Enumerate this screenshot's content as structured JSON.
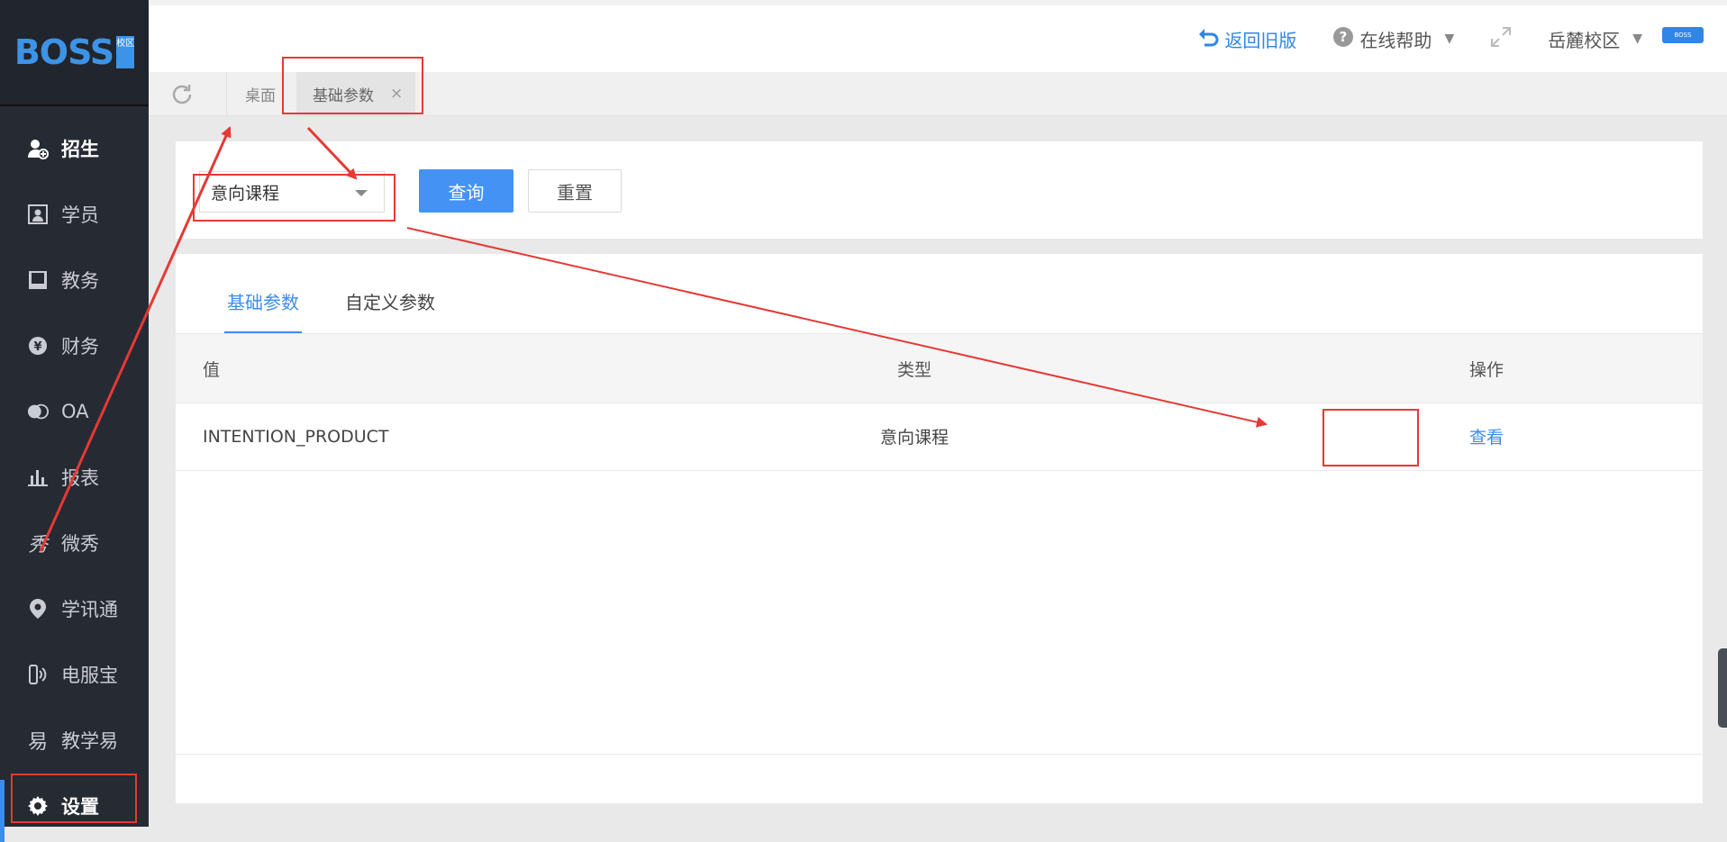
{
  "sidebar": {
    "logo": "BOSS",
    "logo_mark": "校区",
    "items": [
      {
        "label": "招生",
        "icon": "user-add-icon"
      },
      {
        "label": "学员",
        "icon": "student-card-icon"
      },
      {
        "label": "教务",
        "icon": "book-icon"
      },
      {
        "label": "财务",
        "icon": "yen-icon"
      },
      {
        "label": "OA",
        "icon": "chat-icon"
      },
      {
        "label": "报表",
        "icon": "bar-chart-icon"
      },
      {
        "label": "微秀",
        "icon": "xiu-icon"
      },
      {
        "label": "学讯通",
        "icon": "location-pin-icon"
      },
      {
        "label": "电服宝",
        "icon": "phone-service-icon"
      },
      {
        "label": "教学易",
        "icon": "teach-icon"
      },
      {
        "label": "设置",
        "icon": "gear-icon"
      }
    ]
  },
  "topbar": {
    "back_old": "返回旧版",
    "help": "在线帮助",
    "campus": "岳麓校区",
    "avatar_text": "BOSS"
  },
  "tabs": {
    "desk": "桌面",
    "basic": "基础参数",
    "close": "×"
  },
  "filter": {
    "select_value": "意向课程",
    "query": "查询",
    "reset": "重置"
  },
  "subtabs": {
    "basic": "基础参数",
    "custom": "自定义参数"
  },
  "table": {
    "headers": [
      "值",
      "类型",
      "操作"
    ],
    "rows": [
      {
        "value": "INTENTION_PRODUCT",
        "type": "意向课程",
        "action": "查看"
      }
    ]
  },
  "colors": {
    "sidebar_bg": "#262a33",
    "accent": "#3b8cf0",
    "annotation": "#e53935"
  }
}
